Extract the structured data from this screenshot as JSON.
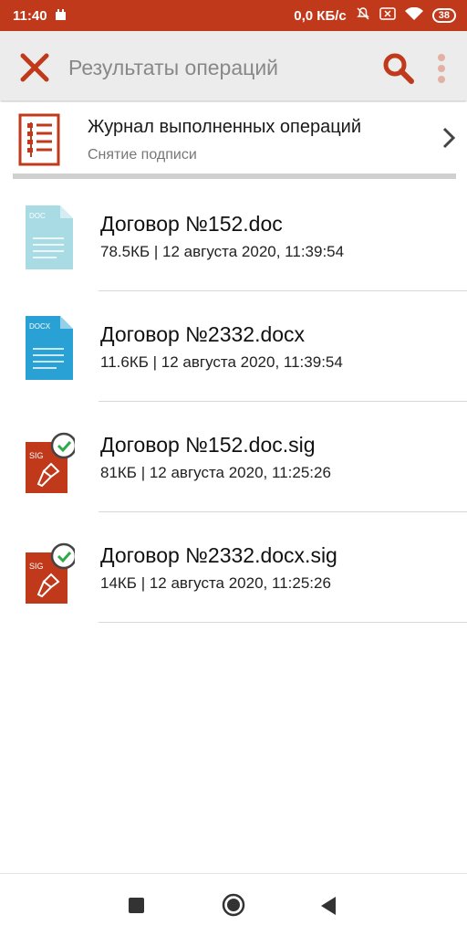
{
  "status_bar": {
    "time": "11:40",
    "network_speed": "0,0 КБ/с",
    "battery": "38",
    "icons": [
      "castle-icon",
      "mute-icon",
      "sim-icon",
      "wifi-icon",
      "battery-icon"
    ]
  },
  "toolbar": {
    "title": "Результаты операций",
    "close_icon": "close-icon",
    "search_icon": "search-icon",
    "menu_icon": "overflow-menu-icon"
  },
  "journal": {
    "title": "Журнал выполненных операций",
    "subtitle": "Снятие подписи",
    "icon": "journal-list-icon"
  },
  "files": [
    {
      "name": "Договор №152.doc",
      "meta": "78.5КБ | 12 августа 2020, 11:39:54",
      "icon_type": "doc",
      "icon_label": "DOC",
      "icon_color": "#a9dbe5"
    },
    {
      "name": "Договор №2332.docx",
      "meta": "11.6КБ | 12 августа 2020, 11:39:54",
      "icon_type": "docx",
      "icon_label": "DOCX",
      "icon_color": "#2aa1d4"
    },
    {
      "name": "Договор №152.doc.sig",
      "meta": "81КБ | 12 августа 2020, 11:25:26",
      "icon_type": "sig",
      "icon_label": "SIG",
      "icon_color": "#c0391b"
    },
    {
      "name": "Договор №2332.docx.sig",
      "meta": "14КБ | 12 августа 2020, 11:25:26",
      "icon_type": "sig",
      "icon_label": "SIG",
      "icon_color": "#c0391b"
    }
  ],
  "colors": {
    "accent": "#c0391b",
    "check": "#2eaa4a"
  }
}
